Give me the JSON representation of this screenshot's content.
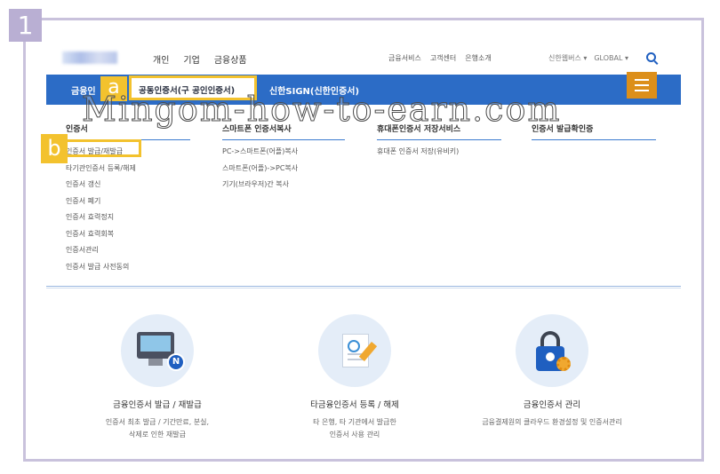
{
  "step_number": "1",
  "header": {
    "nav_left": [
      "개인",
      "기업",
      "금융상품"
    ],
    "nav_right": [
      "금융서비스",
      "고객센터",
      "은행소개"
    ],
    "util": [
      "신한웹버스 ▾",
      "GLOBAL ▾"
    ]
  },
  "bluebar": {
    "label1": "금융인",
    "tab_active": "공동인증서(구 공인인증서)",
    "label2": "신한SIGN(신한인증서)"
  },
  "badges": {
    "a": "a",
    "b": "b"
  },
  "watermark": "Mingom-how-to-earn.com",
  "columns": [
    {
      "heading": "인증서",
      "items": [
        "인증서 발급/재발급",
        "타기관인증서 등록/해제",
        "인증서 갱신",
        "인증서 폐기",
        "인증서 효력정지",
        "인증서 효력회복",
        "인증서관리",
        "인증서 발급 사전동의"
      ]
    },
    {
      "heading": "스마트폰 인증서복사",
      "items": [
        "PC->스마트폰(어플)복사",
        "스마트폰(어플)->PC복사",
        "기기(브라우저)간 복사"
      ]
    },
    {
      "heading": "휴대폰인증서 저장서비스",
      "items": [
        "휴대폰 인증서 저장(유비키)"
      ]
    },
    {
      "heading": "인증서 발급확인증",
      "items": []
    }
  ],
  "cards": [
    {
      "icon": "monitor-icon",
      "title": "금융인증서 발급 / 재발급",
      "desc1": "인증서 최초 발급 / 기간만료, 분실,",
      "desc2": "삭제로 인한 재발급",
      "badge": "N"
    },
    {
      "icon": "document-pen-icon",
      "title": "타금융인증서 등록 / 해제",
      "desc1": "타 은행, 타 기관에서 발급한",
      "desc2": "인증서 사용 관리"
    },
    {
      "icon": "lock-gear-icon",
      "title": "금융인증서 관리",
      "desc1": "금융결제원의 클라우드 환경설정 및 인증서관리",
      "desc2": ""
    }
  ]
}
